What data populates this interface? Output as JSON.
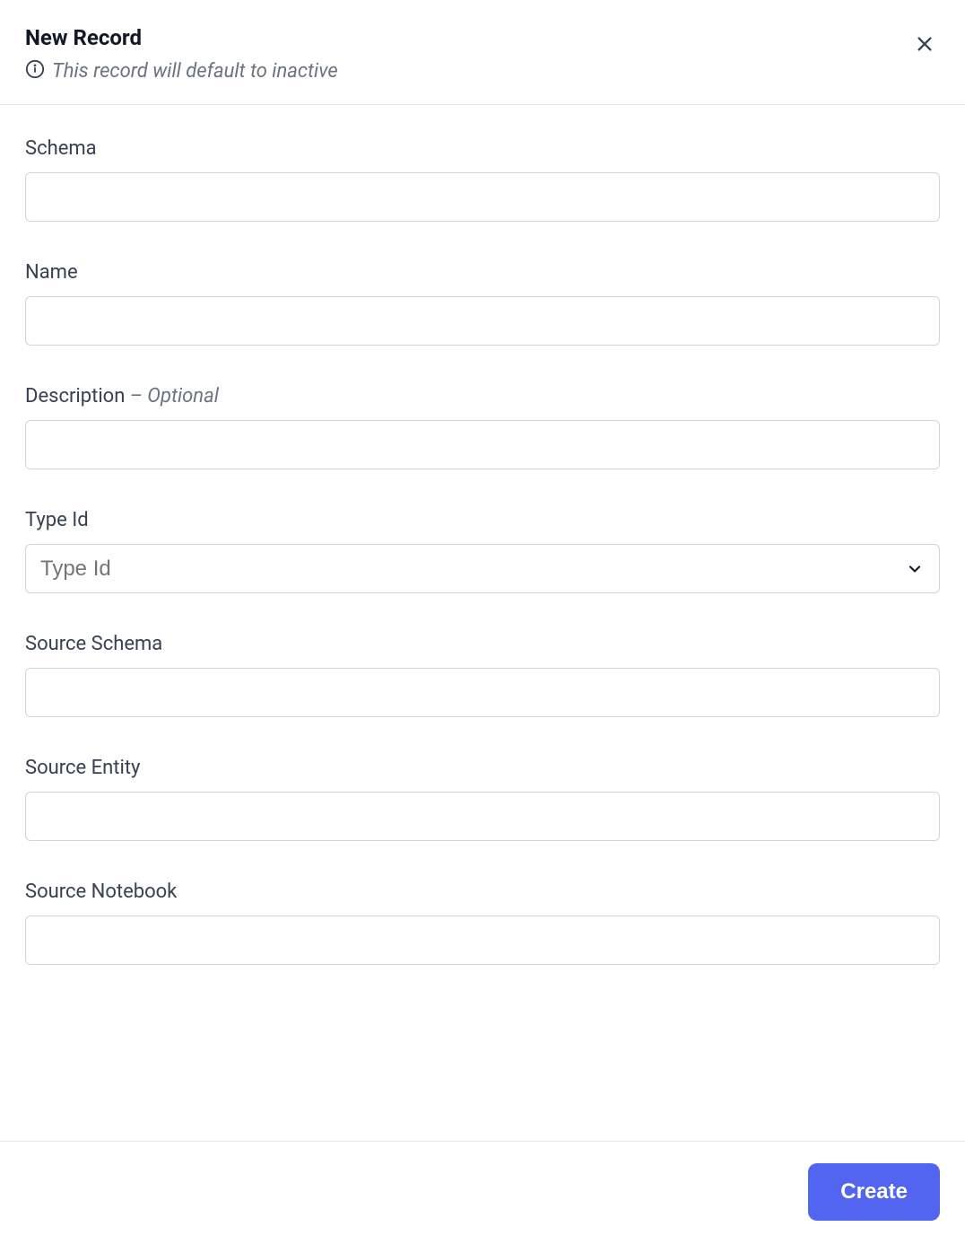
{
  "header": {
    "title": "New Record",
    "subtitle": "This record will default to inactive"
  },
  "form": {
    "schema": {
      "label": "Schema",
      "value": ""
    },
    "name": {
      "label": "Name",
      "value": ""
    },
    "description": {
      "label": "Description",
      "optional_suffix": " – Optional",
      "value": ""
    },
    "type_id": {
      "label": "Type Id",
      "placeholder": "Type Id",
      "value": ""
    },
    "source_schema": {
      "label": "Source Schema",
      "value": ""
    },
    "source_entity": {
      "label": "Source Entity",
      "value": ""
    },
    "source_notebook": {
      "label": "Source Notebook",
      "value": ""
    }
  },
  "footer": {
    "create_label": "Create"
  }
}
